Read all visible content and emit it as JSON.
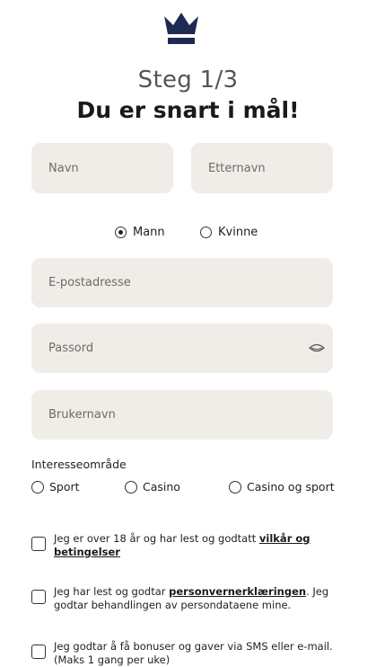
{
  "header": {
    "step": "Steg 1/3",
    "title": "Du er snart i mål!"
  },
  "form": {
    "first_name_placeholder": "Navn",
    "last_name_placeholder": "Etternavn",
    "gender": {
      "options": [
        {
          "label": "Mann",
          "selected": true
        },
        {
          "label": "Kvinne",
          "selected": false
        }
      ]
    },
    "email_placeholder": "E-postadresse",
    "password_placeholder": "Passord",
    "username_placeholder": "Brukernavn",
    "interest": {
      "label": "Interesseområde",
      "options": [
        {
          "label": "Sport",
          "selected": false
        },
        {
          "label": "Casino",
          "selected": false
        },
        {
          "label": "Casino og sport",
          "selected": false
        }
      ]
    },
    "consents": [
      {
        "before": "Jeg er over 18 år og har lest og godtatt ",
        "link": "vilkår og betingelser",
        "after": "",
        "checked": false
      },
      {
        "before": "Jeg har lest og godtar ",
        "link": "personvernerklæringen",
        "after": ". Jeg godtar behandlingen av persondataene mine.",
        "checked": false
      },
      {
        "before": "Jeg godtar å få bonuser og gaver via SMS eller e-mail. (Maks 1 gang per uke)",
        "link": "",
        "after": "",
        "checked": false
      }
    ]
  },
  "colors": {
    "brand": "#1e2a52",
    "field_bg": "#f0ece8"
  },
  "icons": {
    "logo": "crown-icon",
    "password_toggle": "eye-icon"
  }
}
